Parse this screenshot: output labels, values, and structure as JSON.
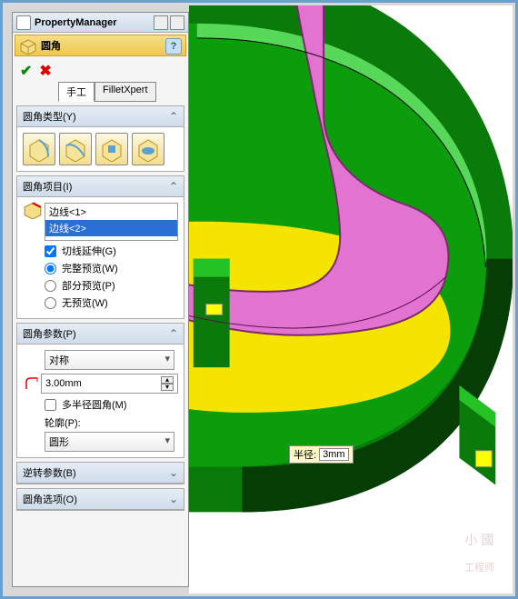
{
  "pm": {
    "title": "PropertyManager"
  },
  "feature": {
    "title": "圆角"
  },
  "tabs": {
    "manual": "手工",
    "filletxpert": "FilletXpert"
  },
  "sections": {
    "type": {
      "title": "圆角类型(Y)"
    },
    "items": {
      "title": "圆角项目(I)",
      "list": [
        "边线<1>",
        "边线<2>"
      ],
      "tangent": "切线延伸(G)",
      "full": "完整预览(W)",
      "partial": "部分预览(P)",
      "none": "无预览(W)"
    },
    "params": {
      "title": "圆角参数(P)",
      "symmetry": "对称",
      "radius": "3.00mm",
      "multi": "多半径圆角(M)",
      "profile_label": "轮廓(P):",
      "profile": "圆形"
    },
    "reverse": {
      "title": "逆转参数(B)"
    },
    "options": {
      "title": "圆角选项(O)"
    }
  },
  "hint": {
    "label": "半径:",
    "value": "3mm"
  },
  "watermark": {
    "small": "小 國",
    "big": "工程师"
  }
}
